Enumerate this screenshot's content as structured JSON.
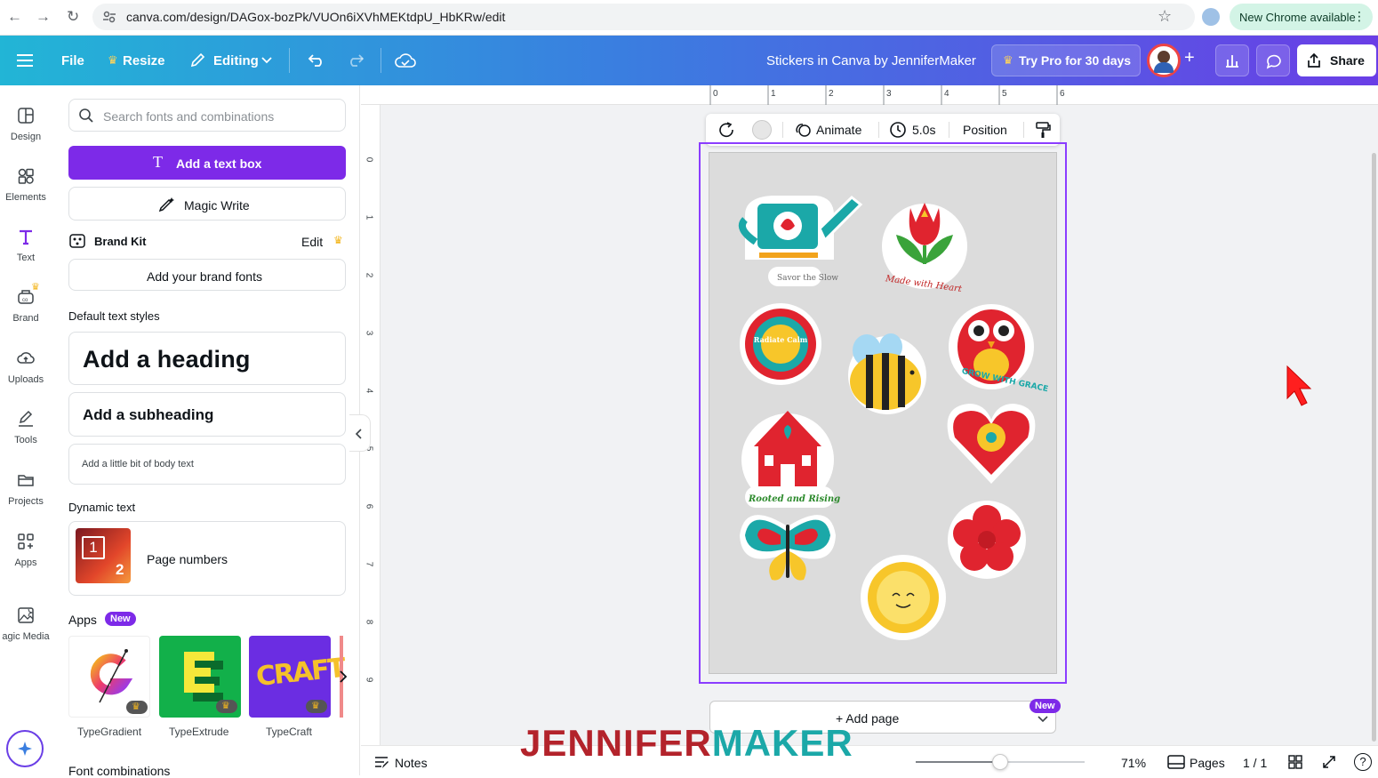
{
  "browser": {
    "url": "canva.com/design/DAGox-bozPk/VUOn6iXVhMEKtdpU_HbKRw/edit",
    "update_label": "New Chrome available"
  },
  "toolbar": {
    "file": "File",
    "resize": "Resize",
    "editing": "Editing",
    "doc_title": "Stickers in Canva by JenniferMaker",
    "try_pro": "Try Pro for 30 days",
    "share": "Share"
  },
  "rail": {
    "items": [
      {
        "label": "Design",
        "icon": "layout-icon"
      },
      {
        "label": "Elements",
        "icon": "shapes-icon"
      },
      {
        "label": "Text",
        "icon": "text-icon"
      },
      {
        "label": "Brand",
        "icon": "brand-icon"
      },
      {
        "label": "Uploads",
        "icon": "cloud-upload-icon"
      },
      {
        "label": "Tools",
        "icon": "pen-tool-icon"
      },
      {
        "label": "Projects",
        "icon": "folder-icon"
      },
      {
        "label": "Apps",
        "icon": "apps-grid-icon"
      },
      {
        "label": "agic Media",
        "icon": "magic-media-icon"
      }
    ]
  },
  "panel": {
    "search_placeholder": "Search fonts and combinations",
    "add_text_box": "Add a text box",
    "magic_write": "Magic Write",
    "brand_kit": "Brand Kit",
    "edit": "Edit",
    "add_brand_fonts": "Add your brand fonts",
    "default_styles": "Default text styles",
    "heading": "Add a heading",
    "subheading": "Add a subheading",
    "body": "Add a little bit of body text",
    "dynamic_text": "Dynamic text",
    "page_numbers": "Page numbers",
    "apps_label": "Apps",
    "new_badge": "New",
    "apps": [
      "TypeGradient",
      "TypeExtrude",
      "TypeCraft"
    ],
    "font_combinations": "Font combinations"
  },
  "canvas": {
    "ruler_h": [
      "0",
      "1",
      "2",
      "3",
      "4",
      "5",
      "6"
    ],
    "ruler_v": [
      "0",
      "1",
      "2",
      "3",
      "4",
      "5",
      "6",
      "7",
      "8",
      "9"
    ],
    "context": {
      "animate": "Animate",
      "duration": "5.0s",
      "position": "Position"
    },
    "stickers": {
      "watering_can": "Savor the Slow",
      "tulip": "Made with Heart",
      "mandala": "Radiate Calm",
      "owl": "GROW WITH GRACE",
      "house": "Rooted and Rising"
    },
    "add_page": "+ Add page",
    "add_page_badge": "New",
    "watermark_a": "JENNIFER",
    "watermark_b": "MAKER"
  },
  "footer": {
    "notes": "Notes",
    "zoom_level": 0.71,
    "zoom": "71%",
    "pages": "Pages",
    "page_count": "1 / 1"
  },
  "colors": {
    "accent_purple": "#7d2ae8",
    "sticker_red": "#e0242f",
    "sticker_teal": "#1ba8a8",
    "sticker_yellow": "#f7c62a"
  }
}
